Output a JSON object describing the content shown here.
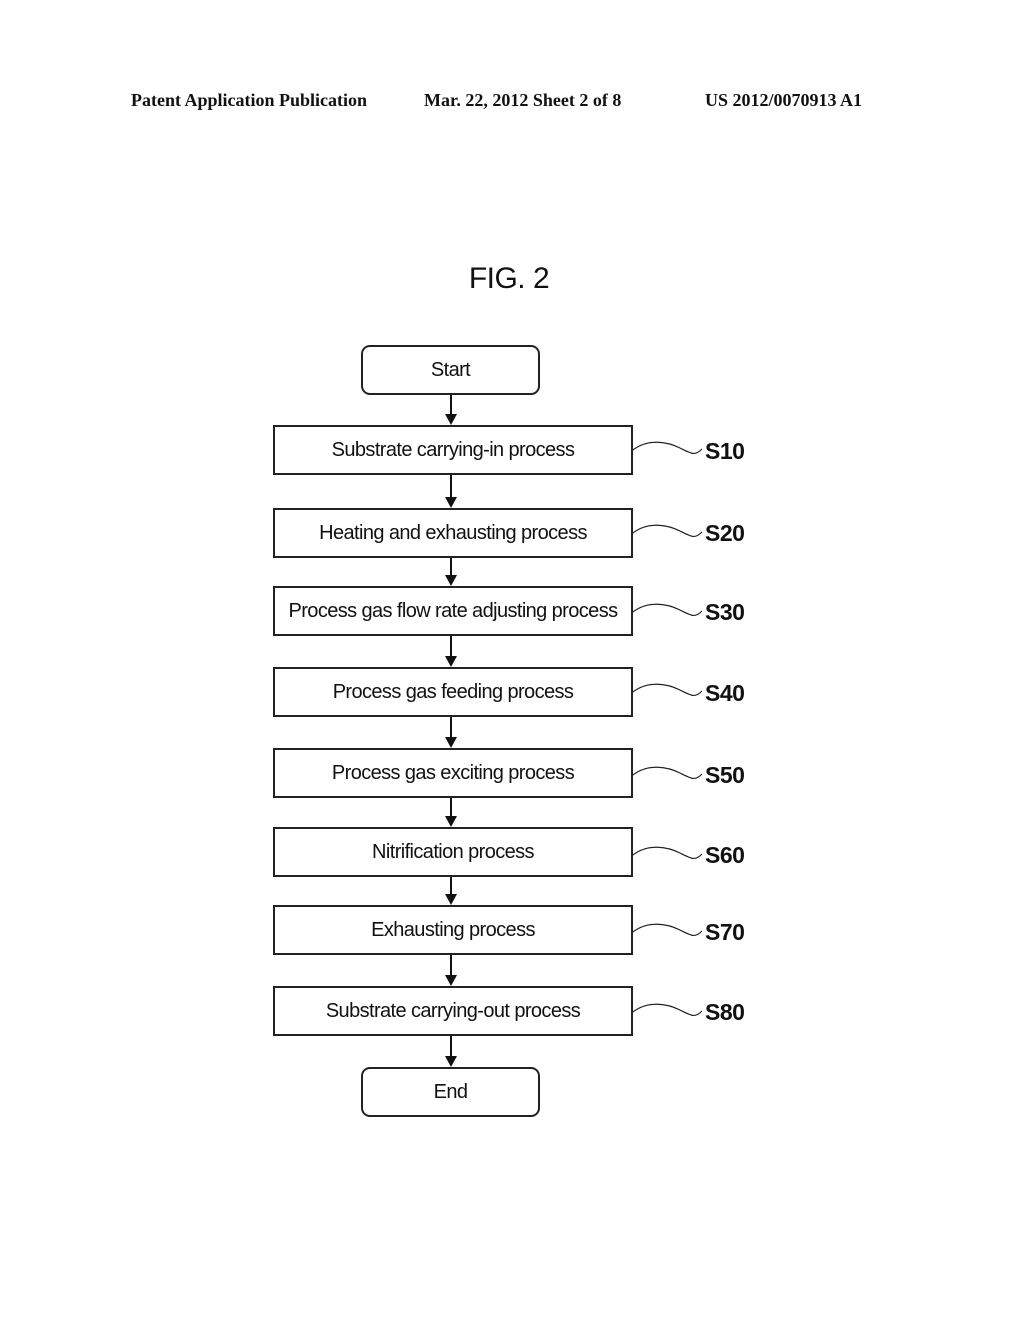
{
  "header": {
    "publication": "Patent Application Publication",
    "date_sheet": "Mar. 22, 2012  Sheet 2 of 8",
    "number": "US 2012/0070913 A1"
  },
  "figure": {
    "title": "FIG. 2",
    "start_label": "Start",
    "end_label": "End",
    "steps": [
      {
        "label": "Substrate carrying-in process",
        "ref": "S10"
      },
      {
        "label": "Heating and exhausting process",
        "ref": "S20"
      },
      {
        "label": "Process gas flow rate adjusting process",
        "ref": "S30"
      },
      {
        "label": "Process gas feeding process",
        "ref": "S40"
      },
      {
        "label": "Process gas exciting process",
        "ref": "S50"
      },
      {
        "label": "Nitrification process",
        "ref": "S60"
      },
      {
        "label": "Exhausting process",
        "ref": "S70"
      },
      {
        "label": "Substrate carrying-out process",
        "ref": "S80"
      }
    ]
  }
}
